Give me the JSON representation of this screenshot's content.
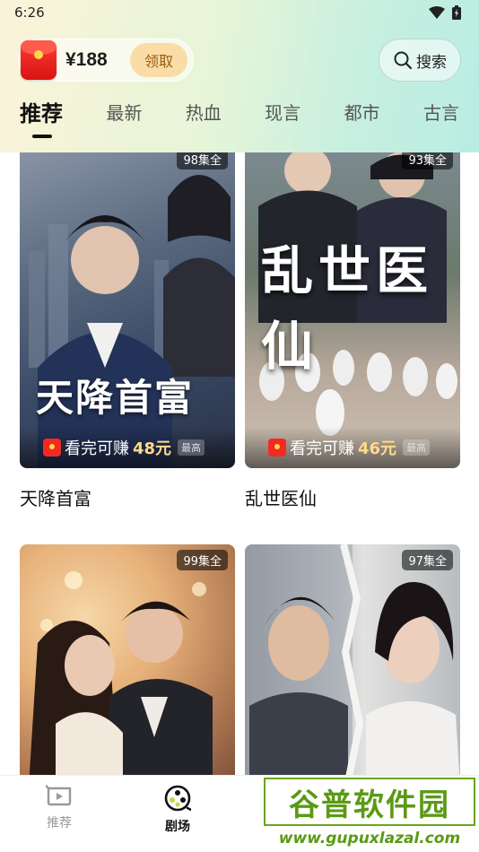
{
  "status_bar": {
    "time": "6:26"
  },
  "header": {
    "reward_amount": "¥188",
    "claim_label": "领取",
    "search_label": "搜索"
  },
  "tabs": [
    {
      "label": "推荐",
      "active": true
    },
    {
      "label": "最新"
    },
    {
      "label": "热血"
    },
    {
      "label": "现言"
    },
    {
      "label": "都市"
    },
    {
      "label": "古言"
    }
  ],
  "cards": [
    {
      "title": "天降首富",
      "episodes": "98集全",
      "earn_prefix": "看完可赚",
      "earn_amount": "48元",
      "earn_tag": "最高",
      "poster_text": "天降首富"
    },
    {
      "title": "乱世医仙",
      "episodes": "93集全",
      "earn_prefix": "看完可赚",
      "earn_amount": "46元",
      "earn_tag": "最高",
      "poster_text": "乱世医仙"
    },
    {
      "title": "",
      "episodes": "99集全"
    },
    {
      "title": "",
      "episodes": "97集全"
    }
  ],
  "bottom_nav": [
    {
      "label": "推荐",
      "icon": "tv-play-icon"
    },
    {
      "label": "剧场",
      "icon": "film-reel-icon",
      "active": true
    }
  ],
  "watermark": {
    "name": "谷普软件园",
    "url": "www.gupuxlazal.com"
  }
}
